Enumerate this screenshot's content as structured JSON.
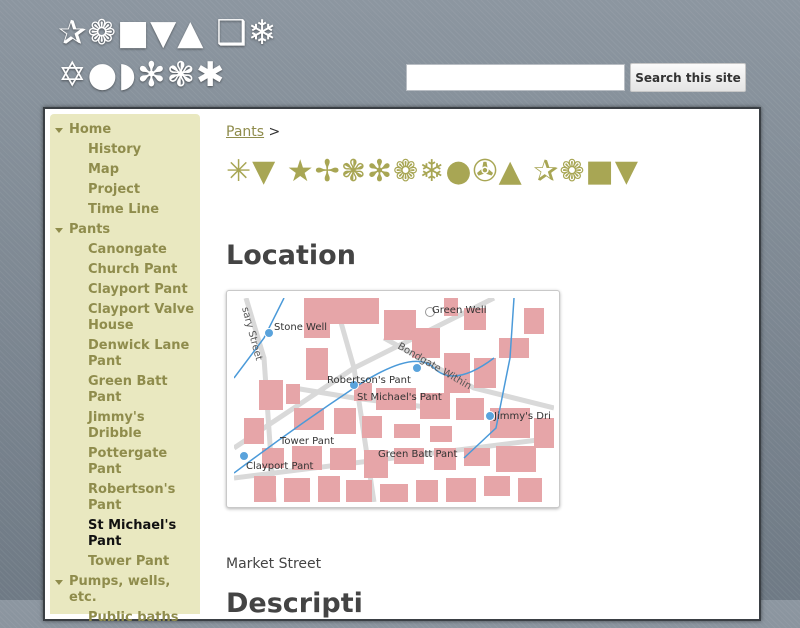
{
  "header": {
    "title_line1": "✰❁■▼▲ ❑❄",
    "title_line2": "✡●◗✻❃✱",
    "search": {
      "placeholder": "",
      "value": "",
      "button_label": "Search this site"
    }
  },
  "sidebar": {
    "items": [
      {
        "label": "Home",
        "kind": "group"
      },
      {
        "label": "History",
        "kind": "sub"
      },
      {
        "label": "Map",
        "kind": "sub"
      },
      {
        "label": "Project",
        "kind": "sub"
      },
      {
        "label": "Time Line",
        "kind": "sub"
      },
      {
        "label": "Pants",
        "kind": "group"
      },
      {
        "label": "Canongate",
        "kind": "sub"
      },
      {
        "label": "Church Pant",
        "kind": "sub"
      },
      {
        "label": "Clayport Pant",
        "kind": "sub"
      },
      {
        "label": "Clayport Valve House",
        "kind": "sub"
      },
      {
        "label": "Denwick Lane Pant",
        "kind": "sub"
      },
      {
        "label": "Green Batt Pant",
        "kind": "sub"
      },
      {
        "label": "Jimmy's Dribble",
        "kind": "sub"
      },
      {
        "label": "Pottergate Pant",
        "kind": "sub"
      },
      {
        "label": "Robertson's Pant",
        "kind": "sub"
      },
      {
        "label": "St Michael's Pant",
        "kind": "sub",
        "active": true
      },
      {
        "label": "Tower Pant",
        "kind": "sub"
      },
      {
        "label": "Pumps, wells, etc.",
        "kind": "group"
      },
      {
        "label": "Public baths",
        "kind": "sub"
      }
    ]
  },
  "breadcrumb": {
    "link": "Pants",
    "separator": ">"
  },
  "page_title": "✳▼ ★✢❃✻❁❄●✇▲ ✰❁■▼",
  "location": {
    "heading": "Location",
    "map_labels": {
      "green_well": "Green Well",
      "stone_well": "Stone Well",
      "robertsons": "Robertson's Pant",
      "st_michaels": "St Michael's Pant",
      "jimmys": "Jimmy's Dri",
      "tower": "Tower Pant",
      "green_batt": "Green Batt Pant",
      "clayport": "Clayport Pant",
      "street_bondgate": "Bondgate Within",
      "street_sary": "sary Street"
    },
    "street": "Market Street"
  },
  "description_heading": "Descripti",
  "colors": {
    "accent": "#a8a654",
    "nav": "#8f8c4c",
    "sidebar_bg": "#e9e8c0",
    "building": "#e6a5a8",
    "water": "#4b9ad9",
    "marker": "#5aa3dc"
  }
}
